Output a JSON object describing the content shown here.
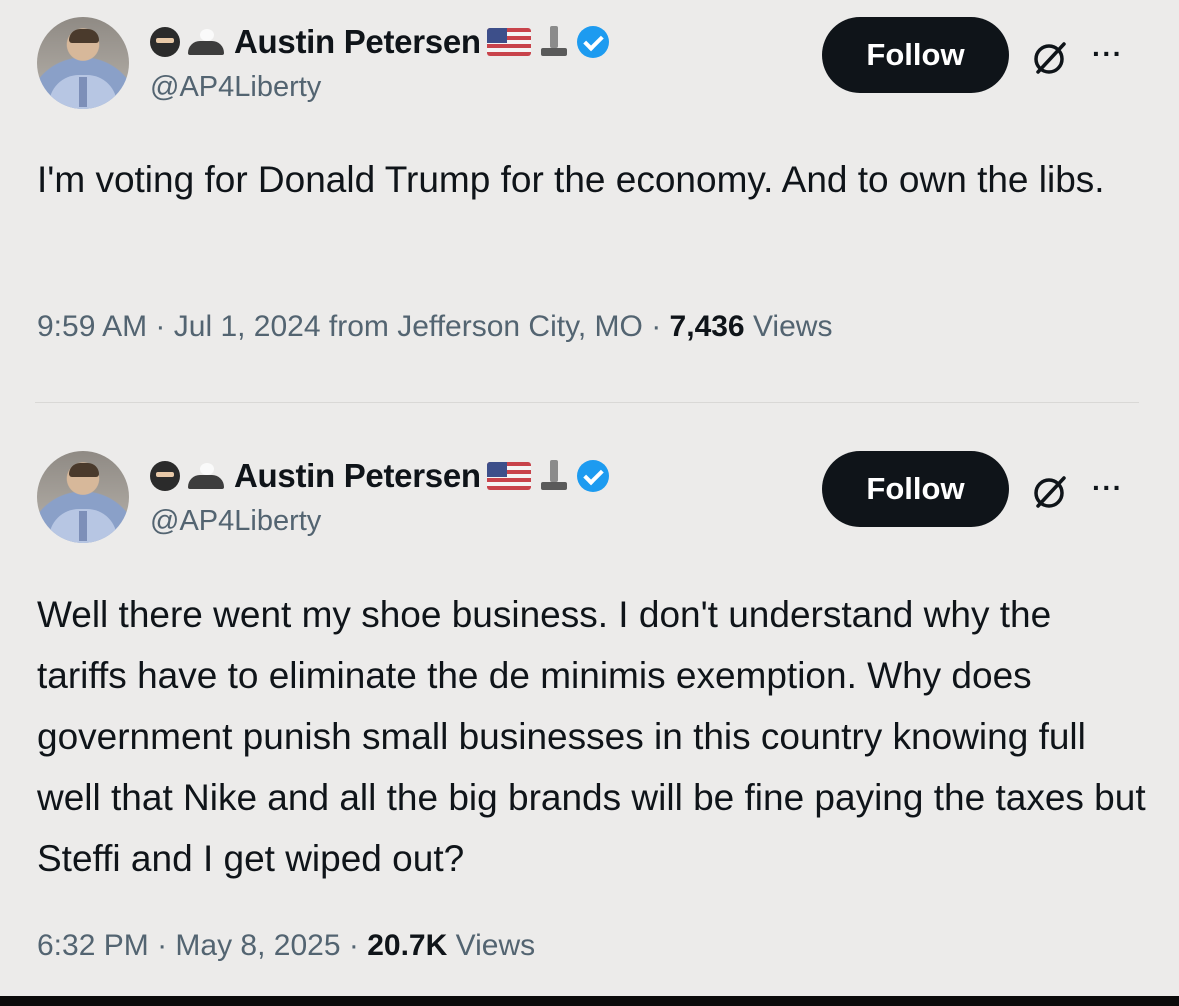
{
  "tweets": [
    {
      "author": {
        "name": "Austin Petersen",
        "handle": "@AP4Liberty"
      },
      "follow_label": "Follow",
      "more_label": "···",
      "text": "I'm voting for Donald Trump for the economy. And to own the libs.",
      "time": "9:59 AM",
      "date": "Jul 1, 2024",
      "location": "from Jefferson City, MO",
      "views_count": "7,436",
      "views_label": "Views"
    },
    {
      "author": {
        "name": "Austin Petersen",
        "handle": "@AP4Liberty"
      },
      "follow_label": "Follow",
      "more_label": "···",
      "text": "Well there went my shoe business. I don't understand why the tariffs have to eliminate the de minimis exemption. Why does government punish small businesses in this country knowing full well that Nike and all the big brands will be fine paying the taxes but Steffi and I get wiped out?",
      "time": "6:32 PM",
      "date": "May 8, 2025",
      "location": "",
      "views_count": "20.7K",
      "views_label": "Views"
    }
  ],
  "separator": "·",
  "colors": {
    "background": "#ecebea",
    "text": "#0f1419",
    "secondary_text": "#536471",
    "follow_button": "#0f1419",
    "verified_badge": "#1d9bf0"
  },
  "icons": [
    "ninja-emoji-icon",
    "eagle-emoji-icon",
    "us-flag-icon",
    "pillar-emoji-icon",
    "verified-badge-icon",
    "grok-icon",
    "more-options-icon"
  ]
}
